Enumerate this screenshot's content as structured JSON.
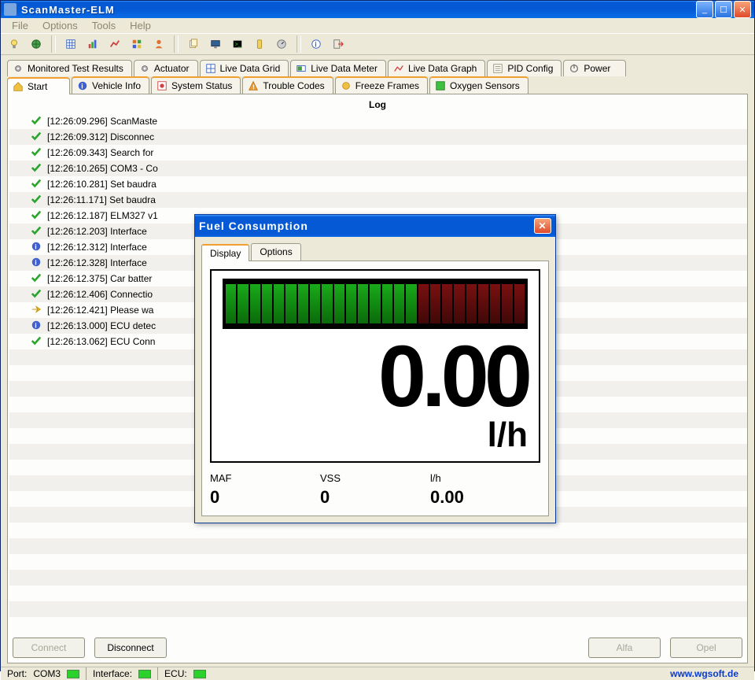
{
  "window": {
    "title": "ScanMaster-ELM"
  },
  "menu": [
    "File",
    "Options",
    "Tools",
    "Help"
  ],
  "tabs_row1": [
    {
      "label": "Monitored Test Results",
      "icon": "gear-icon"
    },
    {
      "label": "Actuator",
      "icon": "gear-icon"
    },
    {
      "label": "Live Data Grid",
      "icon": "grid-icon"
    },
    {
      "label": "Live Data Meter",
      "icon": "meter-icon"
    },
    {
      "label": "Live Data Graph",
      "icon": "graph-icon"
    },
    {
      "label": "PID Config",
      "icon": "list-icon"
    },
    {
      "label": "Power",
      "icon": "power-icon"
    }
  ],
  "tabs_row2": [
    {
      "label": "Start",
      "icon": "home-icon",
      "active": true
    },
    {
      "label": "Vehicle Info",
      "icon": "info-icon"
    },
    {
      "label": "System Status",
      "icon": "status-icon"
    },
    {
      "label": "Trouble Codes",
      "icon": "warn-icon"
    },
    {
      "label": "Freeze Frames",
      "icon": "freeze-icon"
    },
    {
      "label": "Oxygen Sensors",
      "icon": "o2-icon"
    }
  ],
  "log_title": "Log",
  "log": [
    {
      "icon": "check",
      "text": "[12:26:09.296] ScanMaste"
    },
    {
      "icon": "check",
      "text": "[12:26:09.312] Disconnec"
    },
    {
      "icon": "check",
      "text": "[12:26:09.343] Search for"
    },
    {
      "icon": "check",
      "text": "[12:26:10.265] COM3 - Co"
    },
    {
      "icon": "check",
      "text": "[12:26:10.281] Set baudra"
    },
    {
      "icon": "check",
      "text": "[12:26:11.171] Set baudra"
    },
    {
      "icon": "check",
      "text": "[12:26:12.187] ELM327 v1"
    },
    {
      "icon": "check",
      "text": "[12:26:12.203] Interface"
    },
    {
      "icon": "info",
      "text": "[12:26:12.312] Interface"
    },
    {
      "icon": "info",
      "text": "[12:26:12.328] Interface"
    },
    {
      "icon": "check",
      "text": "[12:26:12.375] Car batter"
    },
    {
      "icon": "check",
      "text": "[12:26:12.406] Connectio"
    },
    {
      "icon": "arrow",
      "text": "[12:26:12.421] Please wa"
    },
    {
      "icon": "info",
      "text": "[12:26:13.000] ECU detec"
    },
    {
      "icon": "check",
      "text": "[12:26:13.062] ECU Conn"
    }
  ],
  "buttons": {
    "connect": "Connect",
    "disconnect": "Disconnect",
    "alfa": "Alfa",
    "opel": "Opel"
  },
  "status": {
    "port_label": "Port:",
    "port": "COM3",
    "iface_label": "Interface:",
    "ecu_label": "ECU:",
    "link": "www.wgsoft.de"
  },
  "dialog": {
    "title": "Fuel Consumption",
    "tabs": [
      "Display",
      "Options"
    ],
    "value": "0.00",
    "unit": "l/h",
    "readouts": [
      {
        "label": "MAF",
        "value": "0"
      },
      {
        "label": "VSS",
        "value": "0"
      },
      {
        "label": "l/h",
        "value": "0.00"
      }
    ],
    "green_segments": 16,
    "red_segments": 9
  }
}
